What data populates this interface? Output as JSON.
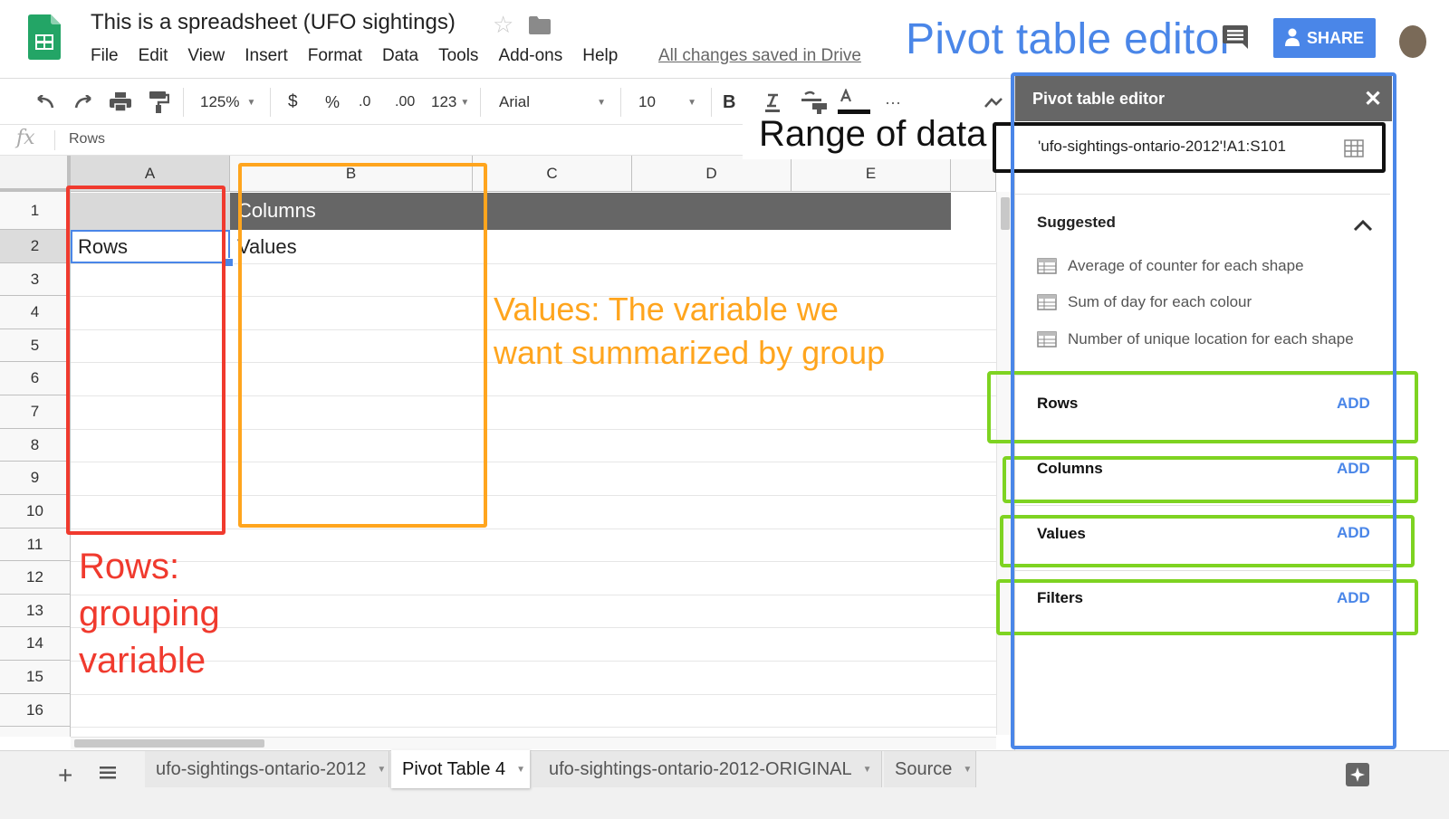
{
  "header": {
    "doc_title": "This is a spreadsheet (UFO sightings)",
    "menu": [
      "File",
      "Edit",
      "View",
      "Insert",
      "Format",
      "Data",
      "Tools",
      "Add-ons",
      "Help"
    ],
    "saved_status": "All changes saved in Drive",
    "share_label": "SHARE"
  },
  "toolbar": {
    "zoom": "125%",
    "currency": "$",
    "percent": "%",
    "decrease_decimals": ".0",
    "increase_decimals": ".00",
    "more_formats": "123",
    "font": "Arial",
    "font_size": "10",
    "bold": "B",
    "more": "···"
  },
  "formula_bar": {
    "fx": "fx",
    "value": "Rows"
  },
  "grid": {
    "columns": [
      "A",
      "B",
      "C",
      "D",
      "E"
    ],
    "rows": [
      "1",
      "2",
      "3",
      "4",
      "5",
      "6",
      "7",
      "8",
      "9",
      "10",
      "11",
      "12",
      "13",
      "14",
      "15",
      "16"
    ],
    "b1": "Columns",
    "a2": "Rows",
    "b2": "Values"
  },
  "annotations": {
    "title": "Pivot table editor",
    "range": "Range of data",
    "values_line1": "Values: The variable we",
    "values_line2": "want summarized by group",
    "rows_line1": "Rows:",
    "rows_line2": "grouping",
    "rows_line3": "variable"
  },
  "panel": {
    "title": "Pivot table editor",
    "range_value": "'ufo-sightings-ontario-2012'!A1:S101",
    "suggested_title": "Suggested",
    "suggestions": [
      "Average of counter for each shape",
      "Sum of day for each colour",
      "Number of unique location for each shape"
    ],
    "sections": [
      "Rows",
      "Columns",
      "Values",
      "Filters"
    ],
    "add_label": "ADD"
  },
  "tabs": [
    "ufo-sightings-ontario-2012",
    "Pivot Table 4",
    "ufo-sightings-ontario-2012-ORIGINAL",
    "Source"
  ],
  "colors": {
    "accent_blue": "#4a86e8",
    "annotation_red": "#f03a2e",
    "annotation_orange": "#ffa51e",
    "annotation_green": "#7ed321",
    "header_gray": "#666666"
  }
}
